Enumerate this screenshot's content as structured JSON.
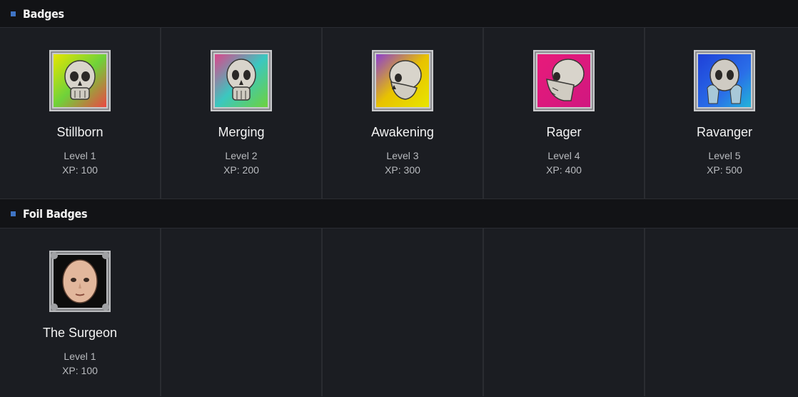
{
  "sections": [
    {
      "title": "Badges",
      "badges": [
        {
          "name": "Stillborn",
          "level": "Level 1",
          "xp": "XP: 100",
          "icon": "skull-badge-icon"
        },
        {
          "name": "Merging",
          "level": "Level 2",
          "xp": "XP: 200",
          "icon": "skull-badge-icon"
        },
        {
          "name": "Awakening",
          "level": "Level 3",
          "xp": "XP: 300",
          "icon": "skull-badge-icon"
        },
        {
          "name": "Rager",
          "level": "Level 4",
          "xp": "XP: 400",
          "icon": "skull-badge-icon"
        },
        {
          "name": "Ravanger",
          "level": "Level 5",
          "xp": "XP: 500",
          "icon": "skull-badge-icon"
        }
      ]
    },
    {
      "title": "Foil Badges",
      "badges": [
        {
          "name": "The Surgeon",
          "level": "Level 1",
          "xp": "XP: 100",
          "icon": "face-badge-icon"
        }
      ]
    }
  ],
  "colors": {
    "accent": "#3f74c4",
    "background": "#1b1d22",
    "header_bg": "#121316"
  }
}
